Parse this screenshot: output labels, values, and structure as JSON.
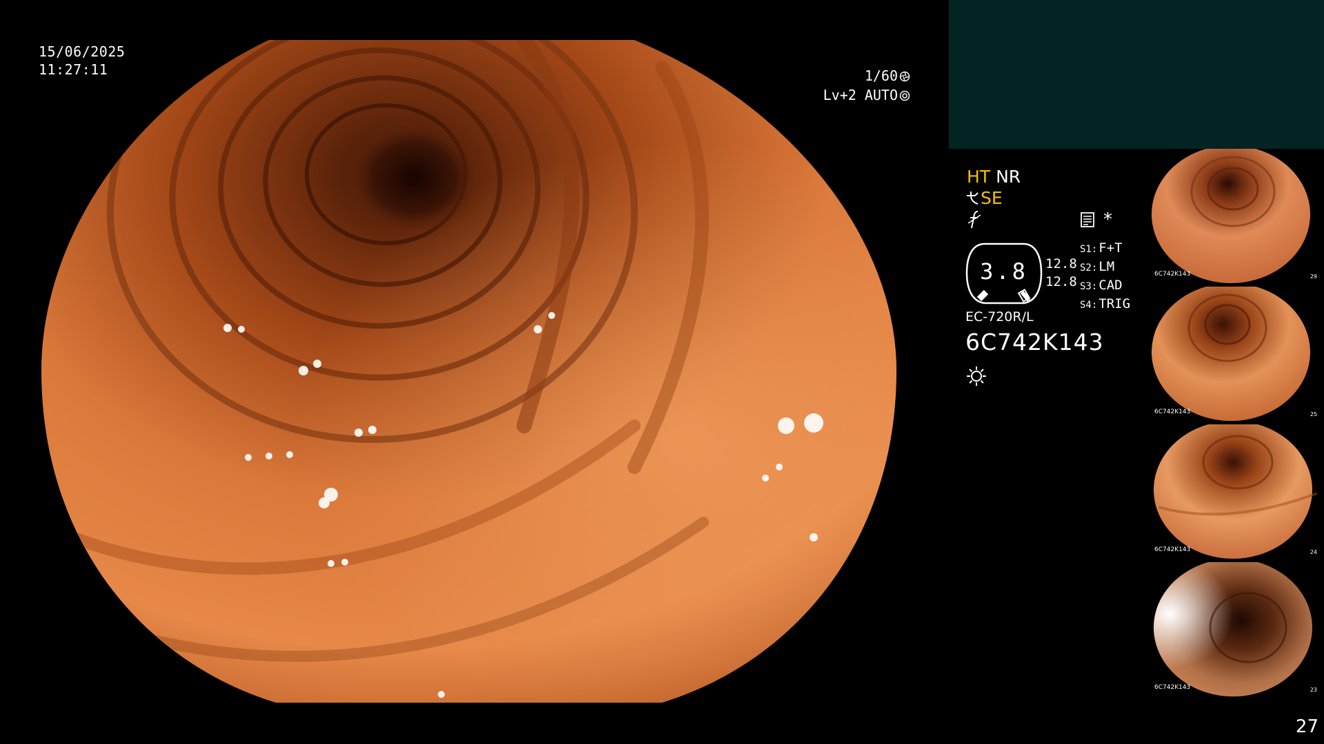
{
  "overlay": {
    "date": "15/06/2025",
    "time": "11:27:11",
    "shutter": "1/60",
    "light_mode": "Lv+2 AUTO",
    "shutter_icon": "aperture-icon",
    "auto_icon": "auto-exposure-icon"
  },
  "modes": {
    "primary": "HT",
    "secondary": "NR",
    "enhance": "SE",
    "enhance_icon": "enhancement-icon",
    "freeze_icon": "freeze-icon",
    "note_icon": "note-icon",
    "marker": "*"
  },
  "gauge": {
    "value": "3.8"
  },
  "exposure_values": [
    "12.8",
    "12.8"
  ],
  "scope_settings": [
    {
      "key": "S1:",
      "value": "F+T"
    },
    {
      "key": "S2:",
      "value": "LM"
    },
    {
      "key": "S3:",
      "value": "CAD"
    },
    {
      "key": "S4:",
      "value": "TRIG"
    }
  ],
  "scope": {
    "model": "EC-720R/L",
    "serial": "6C742K143",
    "light_icon": "light-icon"
  },
  "thumbnails": [
    {
      "label": "6C742K143",
      "index": "29"
    },
    {
      "label": "6C742K143",
      "index": "25"
    },
    {
      "label": "6C742K143",
      "index": "24"
    },
    {
      "label": "6C742K143",
      "index": "23"
    }
  ],
  "page_number": "27",
  "colors": {
    "panel": "#022523",
    "accent_yellow": "#f5c000",
    "mucosa": "#d9783a"
  }
}
